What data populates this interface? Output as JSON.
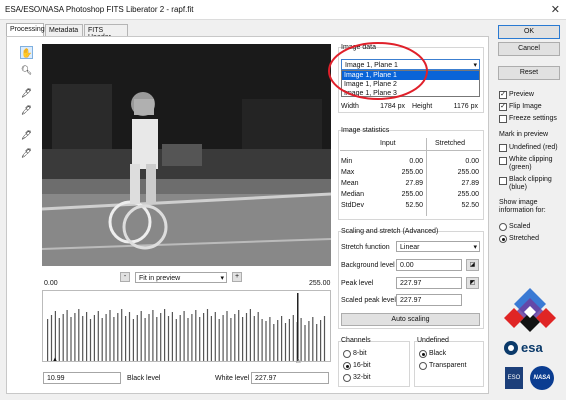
{
  "window": {
    "title": "ESA/ESO/NASA Photoshop FITS Liberator 2 - rapf.fit",
    "close_glyph": "✕"
  },
  "tabs": [
    {
      "label": "Processing",
      "active": true
    },
    {
      "label": "Metadata",
      "active": false
    },
    {
      "label": "FITS Header",
      "active": false
    }
  ],
  "preview": {
    "zoom_minus": "-",
    "zoom_plus": "+",
    "zoom_option": "Fit in preview"
  },
  "histogram": {
    "min_label": "0.00",
    "max_label": "255.00",
    "black_level_value": "10.99",
    "black_level_label": "Black level",
    "white_level_label": "White level",
    "white_level_value": "227.97"
  },
  "image_data": {
    "title": "Image data",
    "selected": "Image 1, Plane 1",
    "options": [
      "Image 1, Plane 1",
      "Image 1, Plane 2",
      "Image 1, Plane 3"
    ],
    "width_label": "Width",
    "width_value": "1784 px",
    "height_label": "Height",
    "height_value": "1176 px"
  },
  "statistics": {
    "title": "Image statistics",
    "col_input": "Input",
    "col_stretched": "Stretched",
    "rows": [
      {
        "label": "Min",
        "input": "0.00",
        "stretched": "0.00"
      },
      {
        "label": "Max",
        "input": "255.00",
        "stretched": "255.00"
      },
      {
        "label": "Mean",
        "input": "27.89",
        "stretched": "27.89"
      },
      {
        "label": "Median",
        "input": "255.00",
        "stretched": "255.00"
      },
      {
        "label": "StdDev",
        "input": "52.50",
        "stretched": "52.50"
      }
    ]
  },
  "scaling": {
    "title": "Scaling and stretch (Advanced)",
    "stretch_label": "Stretch function",
    "stretch_value": "Linear",
    "background_label": "Background level",
    "background_value": "0.00",
    "peak_label": "Peak level",
    "peak_value": "227.97",
    "scaled_peak_label": "Scaled peak level",
    "scaled_peak_value": "227.97",
    "auto_button": "Auto scaling"
  },
  "channels": {
    "title": "Channels",
    "options": [
      "8-bit",
      "16-bit",
      "32-bit"
    ],
    "selected": "16-bit"
  },
  "undefined": {
    "title": "Undefined",
    "options": [
      "Black",
      "Transparent"
    ],
    "selected": "Black"
  },
  "buttons": {
    "ok": "OK",
    "cancel": "Cancel",
    "reset": "Reset"
  },
  "view_options": [
    {
      "label": "Preview",
      "checked": true
    },
    {
      "label": "Flip Image",
      "checked": true
    },
    {
      "label": "Freeze settings",
      "checked": false
    }
  ],
  "mark_preview": {
    "title": "Mark in preview",
    "items": [
      {
        "label": "Undefined (red)",
        "checked": false
      },
      {
        "label": "White clipping (green)",
        "checked": false
      },
      {
        "label": "Black clipping (blue)",
        "checked": false
      }
    ]
  },
  "show_info": {
    "title": "Show image information for:",
    "options": [
      "Scaled",
      "Stretched"
    ],
    "selected": "Stretched"
  },
  "logos": {
    "esa": "esa",
    "eso": "ESO",
    "nasa": "NASA"
  },
  "colors": {
    "annotation": "#e0202a",
    "selection": "#0a64d8",
    "esa_blue": "#0b3a6a",
    "nasa_blue": "#0b3d91"
  }
}
